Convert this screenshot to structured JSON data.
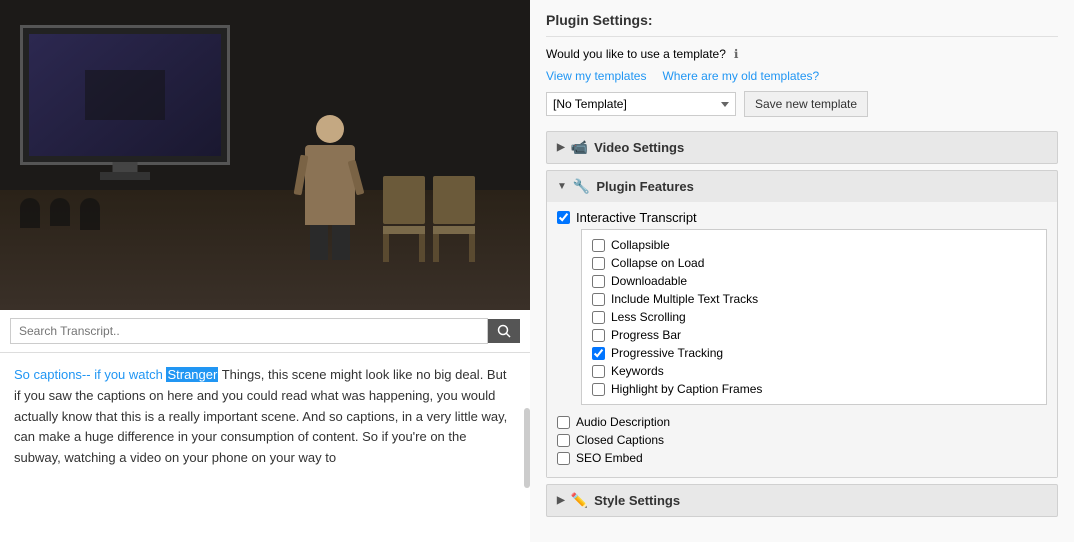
{
  "leftPanel": {
    "search": {
      "placeholder": "Search Transcript..",
      "buttonLabel": "🔍"
    },
    "transcript": {
      "text_before_link": "So captions-- if you watch ",
      "link_text": "Stranger",
      "highlight_word": "Stranger",
      "text_after": " Things, this scene might look like no big deal. But if you saw the captions on here and you could read what was happening, you would actually know that this is a really important scene. And so captions, in a very little way, can make a huge difference in your consumption of content. So if you're on the subway, watching a video on your phone on your way to"
    }
  },
  "rightPanel": {
    "pluginSettingsTitle": "Plugin Settings:",
    "templateQuestion": "Would you like to use a template?",
    "links": {
      "viewMyTemplates": "View my templates",
      "whereAreOldTemplates": "Where are my old templates?"
    },
    "templateSelect": {
      "value": "[No Template]",
      "options": [
        "[No Template]"
      ]
    },
    "saveNewTemplateBtn": "Save new template",
    "videoSettings": {
      "label": "Video Settings",
      "icon": "📹",
      "collapsed": true
    },
    "pluginFeatures": {
      "label": "Plugin Features",
      "icon": "🔧",
      "collapsed": false,
      "interactiveTranscript": {
        "label": "Interactive Transcript",
        "checked": true
      },
      "subFeatures": [
        {
          "label": "Collapsible",
          "checked": false
        },
        {
          "label": "Collapse on Load",
          "checked": false
        },
        {
          "label": "Downloadable",
          "checked": false
        },
        {
          "label": "Include Multiple Text Tracks",
          "checked": false
        },
        {
          "label": "Less Scrolling",
          "checked": false
        },
        {
          "label": "Progress Bar",
          "checked": false
        },
        {
          "label": "Progressive Tracking",
          "checked": true
        },
        {
          "label": "Keywords",
          "checked": false
        },
        {
          "label": "Highlight by Caption Frames",
          "checked": false
        }
      ],
      "mainFeatures": [
        {
          "label": "Audio Description",
          "checked": false
        },
        {
          "label": "Closed Captions",
          "checked": false
        },
        {
          "label": "SEO Embed",
          "checked": false
        }
      ]
    },
    "styleSettings": {
      "label": "Style Settings",
      "icon": "✏️",
      "collapsed": true
    }
  }
}
